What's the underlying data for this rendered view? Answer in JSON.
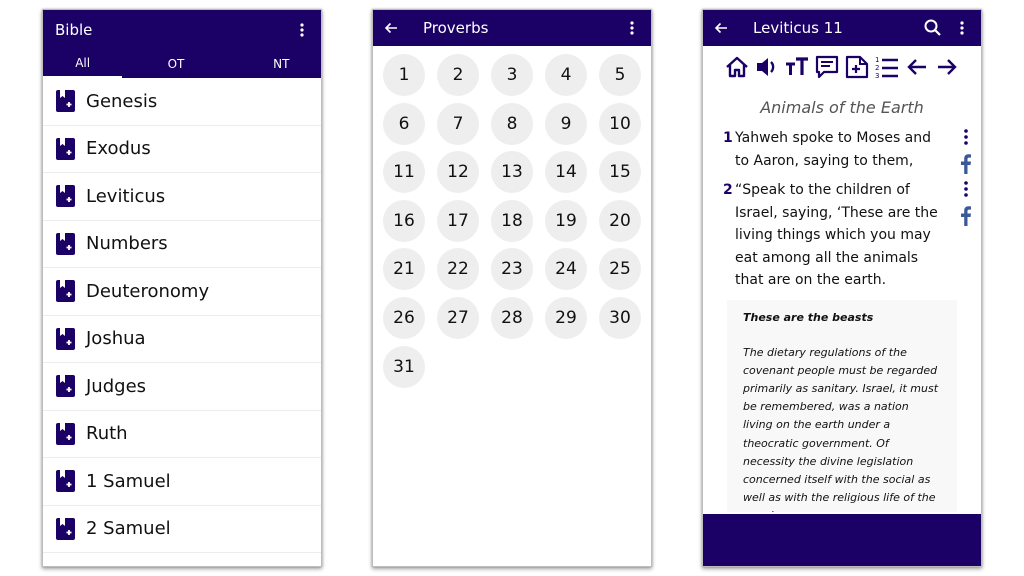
{
  "colors": {
    "primary": "#1b0066",
    "chapter_bg": "#eeeeee",
    "verse_number": "#1b0066",
    "facebook": "#3b5998"
  },
  "books_screen": {
    "title": "Bible",
    "menu_icon": "more-vert-icon",
    "tabs": [
      {
        "label": "All",
        "active": true
      },
      {
        "label": "OT",
        "active": false
      },
      {
        "label": "NT",
        "active": false
      }
    ],
    "book_icon": "bible-book-icon",
    "books": [
      "Genesis",
      "Exodus",
      "Leviticus",
      "Numbers",
      "Deuteronomy",
      "Joshua",
      "Judges",
      "Ruth",
      "1 Samuel",
      "2 Samuel"
    ]
  },
  "chapters_screen": {
    "title": "Proverbs",
    "back_icon": "arrow-back-icon",
    "menu_icon": "more-vert-icon",
    "chapters": [
      "1",
      "2",
      "3",
      "4",
      "5",
      "6",
      "7",
      "8",
      "9",
      "10",
      "11",
      "12",
      "13",
      "14",
      "15",
      "16",
      "17",
      "18",
      "19",
      "20",
      "21",
      "22",
      "23",
      "24",
      "25",
      "26",
      "27",
      "28",
      "29",
      "30",
      "31"
    ]
  },
  "reader_screen": {
    "title": "Leviticus 11",
    "back_icon": "arrow-back-icon",
    "search_icon": "search-icon",
    "menu_icon": "more-vert-icon",
    "toolbar": [
      "home-icon",
      "speaker-icon",
      "text-size-icon",
      "comment-icon",
      "add-note-icon",
      "numbered-list-icon",
      "previous-chapter-icon",
      "next-chapter-icon"
    ],
    "section_title": "Animals of the Earth",
    "verses": [
      {
        "number": "1",
        "text": "Yahweh spoke to Moses and to Aaron, saying to them,"
      },
      {
        "number": "2",
        "text": "“Speak to the children of Israel, saying, ‘These are the living things which you may eat among all the animals that are on the earth."
      }
    ],
    "facebook_label": "f",
    "commentary": {
      "heading": "These are the beasts",
      "body": "The dietary regulations of the covenant people must be regarded primarily as sanitary. Israel, it must be remembered, was a nation living on the earth under a theocratic government. Of necessity the divine legislation concerned itself with the social as well as with the religious life of the people."
    }
  }
}
